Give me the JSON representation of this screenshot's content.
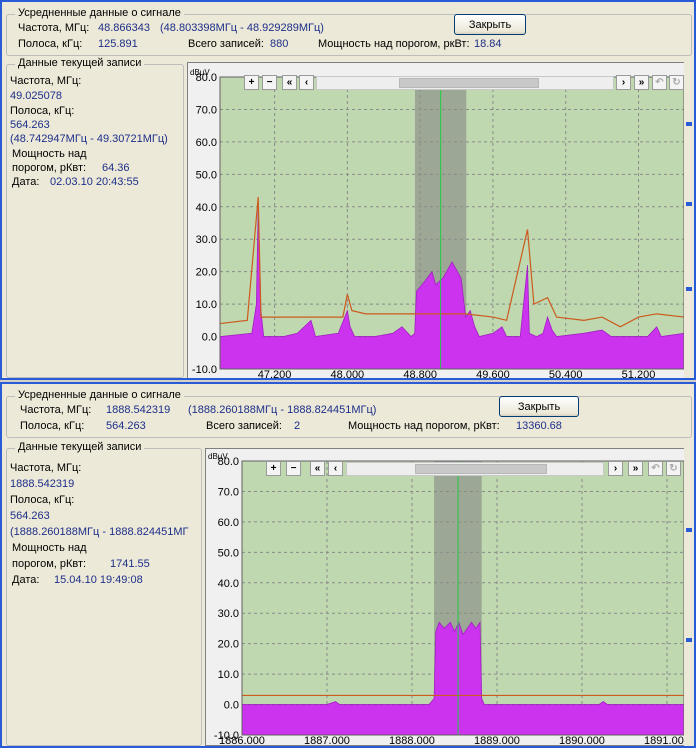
{
  "colors": {
    "accent": "#1d2f8a",
    "spectrum": "#cc33ee",
    "threshold": "#cc5a1e",
    "marker": "#22cc44",
    "plot_bg": "#bfd8b0"
  },
  "icons": [
    "zoom-in-icon",
    "zoom-out-icon",
    "double-chevron-left-icon",
    "chevron-left-icon",
    "chevron-right-icon",
    "double-chevron-right-icon"
  ],
  "panels": [
    {
      "summary": {
        "legend": "Усредненные данные о сигнале",
        "freq_label": "Частота, МГц:",
        "freq_value": "48.866343",
        "freq_range": "(48.803398МГц - 48.929289МГц)",
        "band_label": "Полоса, кГц:",
        "band_value": "125.891",
        "records_label": "Всего записей:",
        "records_value": "880",
        "power_label": "Мощность над порогом, ркВт:",
        "power_value": "18.84",
        "close": "Закрыть"
      },
      "current": {
        "legend": "Данные текущей записи",
        "freq_label": "Частота, МГц:",
        "freq_value": "49.025078",
        "band_label": "Полоса, кГц:",
        "band_value": "564.263",
        "range": "(48.742947МГц - 49.30721МГц)",
        "power_label1": "Мощность над",
        "power_label2": "порогом, рКвт:",
        "power_value": "64.36",
        "date_label": "Дата:",
        "date_value": "02.03.10 20:43:55"
      },
      "chart_data": {
        "type": "area",
        "ylabel": "dBµV",
        "ylim": [
          -10,
          80
        ],
        "yticks": [
          "80.0",
          "70.0",
          "60.0",
          "50.0",
          "40.0",
          "30.0",
          "20.0",
          "10.0",
          "0.0",
          "-10.0"
        ],
        "xlim": [
          46.6,
          51.7
        ],
        "xticks": [
          "47.200",
          "48.000",
          "48.800",
          "49.600",
          "50.400",
          "51.200"
        ],
        "xtick_values": [
          47.2,
          48.0,
          48.8,
          49.6,
          50.4,
          51.2
        ],
        "marker_x": 49.025,
        "band": [
          48.743,
          49.307
        ],
        "spectrum": [
          [
            46.6,
            0
          ],
          [
            46.95,
            1
          ],
          [
            47.0,
            10
          ],
          [
            47.02,
            40
          ],
          [
            47.05,
            8
          ],
          [
            47.08,
            0
          ],
          [
            47.3,
            0
          ],
          [
            47.45,
            1
          ],
          [
            47.6,
            5
          ],
          [
            47.65,
            0
          ],
          [
            47.9,
            1
          ],
          [
            48.0,
            8
          ],
          [
            48.03,
            3
          ],
          [
            48.08,
            0
          ],
          [
            48.3,
            0
          ],
          [
            48.5,
            1
          ],
          [
            48.6,
            3
          ],
          [
            48.7,
            0
          ],
          [
            48.74,
            1
          ],
          [
            48.76,
            14
          ],
          [
            48.85,
            17
          ],
          [
            48.93,
            20
          ],
          [
            48.97,
            16
          ],
          [
            49.05,
            18
          ],
          [
            49.15,
            23
          ],
          [
            49.25,
            18
          ],
          [
            49.3,
            6
          ],
          [
            49.35,
            8
          ],
          [
            49.4,
            3
          ],
          [
            49.45,
            0
          ],
          [
            49.6,
            1
          ],
          [
            49.7,
            3
          ],
          [
            49.75,
            0
          ],
          [
            49.9,
            0
          ],
          [
            49.98,
            22
          ],
          [
            50.0,
            1
          ],
          [
            50.08,
            0
          ],
          [
            50.15,
            1
          ],
          [
            50.2,
            6
          ],
          [
            50.25,
            2
          ],
          [
            50.3,
            0
          ],
          [
            50.6,
            1
          ],
          [
            50.8,
            2
          ],
          [
            50.9,
            0
          ],
          [
            51.3,
            0
          ],
          [
            51.4,
            3
          ],
          [
            51.45,
            0
          ],
          [
            51.7,
            1
          ]
        ],
        "threshold": [
          [
            46.6,
            4
          ],
          [
            46.9,
            5
          ],
          [
            47.02,
            43
          ],
          [
            47.05,
            6
          ],
          [
            47.2,
            6
          ],
          [
            47.6,
            6
          ],
          [
            47.95,
            6
          ],
          [
            48.0,
            13
          ],
          [
            48.05,
            8
          ],
          [
            48.2,
            7
          ],
          [
            48.4,
            7
          ],
          [
            48.6,
            7
          ],
          [
            48.76,
            7
          ],
          [
            49.3,
            7
          ],
          [
            49.6,
            6
          ],
          [
            49.75,
            5
          ],
          [
            49.98,
            33
          ],
          [
            50.05,
            10
          ],
          [
            50.2,
            12
          ],
          [
            50.3,
            6
          ],
          [
            50.6,
            5
          ],
          [
            50.8,
            6
          ],
          [
            51.0,
            3
          ],
          [
            51.2,
            6
          ],
          [
            51.4,
            7
          ],
          [
            51.7,
            6
          ]
        ]
      }
    },
    {
      "summary": {
        "legend": "Усредненные данные о сигнале",
        "freq_label": "Частота, МГц:",
        "freq_value": "1888.542319",
        "freq_range": "(1888.260188МГц - 1888.824451МГц)",
        "band_label": "Полоса, кГц:",
        "band_value": "564.263",
        "records_label": "Всего записей:",
        "records_value": "2",
        "power_label": "Мощность над порогом, рКвт:",
        "power_value": "13360.68",
        "close": "Закрыть"
      },
      "current": {
        "legend": "Данные текущей записи",
        "freq_label": "Частота, МГц:",
        "freq_value": "1888.542319",
        "band_label": "Полоса, кГц:",
        "band_value": "564.263",
        "range": "(1888.260188МГц - 1888.824451МГ",
        "power_label1": "Мощность над",
        "power_label2": "порогом, рКвт:",
        "power_value": "1741.55",
        "date_label": "Дата:",
        "date_value": "15.04.10 19:49:08"
      },
      "chart_data": {
        "type": "area",
        "ylabel": "dBµV",
        "ylim": [
          -10,
          80
        ],
        "yticks": [
          "80.0",
          "70.0",
          "60.0",
          "50.0",
          "40.0",
          "30.0",
          "20.0",
          "10.0",
          "0.0",
          "-10.0"
        ],
        "xlim": [
          1886.0,
          1891.2
        ],
        "xticks": [
          "1886.000",
          "1887.000",
          "1888.000",
          "1889.000",
          "1890.000",
          "1891.000"
        ],
        "xtick_values": [
          1886.0,
          1887.0,
          1888.0,
          1889.0,
          1890.0,
          1891.0
        ],
        "marker_x": 1888.542,
        "band": [
          1888.26,
          1888.82
        ],
        "spectrum": [
          [
            1886.0,
            0
          ],
          [
            1887.0,
            0
          ],
          [
            1887.1,
            1
          ],
          [
            1887.15,
            0
          ],
          [
            1888.2,
            0
          ],
          [
            1888.26,
            2
          ],
          [
            1888.28,
            24
          ],
          [
            1888.32,
            27
          ],
          [
            1888.38,
            25
          ],
          [
            1888.45,
            27
          ],
          [
            1888.5,
            24
          ],
          [
            1888.55,
            27
          ],
          [
            1888.6,
            23
          ],
          [
            1888.65,
            25
          ],
          [
            1888.7,
            27
          ],
          [
            1888.75,
            25
          ],
          [
            1888.8,
            27
          ],
          [
            1888.82,
            2
          ],
          [
            1888.85,
            0
          ],
          [
            1890.2,
            0
          ],
          [
            1890.25,
            1
          ],
          [
            1890.3,
            0
          ],
          [
            1891.2,
            0
          ]
        ],
        "threshold": [
          [
            1886.0,
            3
          ],
          [
            1891.2,
            3
          ]
        ]
      }
    }
  ]
}
